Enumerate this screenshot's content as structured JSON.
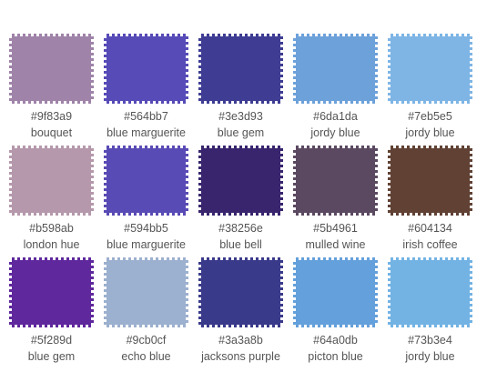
{
  "colors": [
    {
      "hex": "#9f83a9",
      "name": "bouquet"
    },
    {
      "hex": "#564bb7",
      "name": "blue marguerite"
    },
    {
      "hex": "#3e3d93",
      "name": "blue gem"
    },
    {
      "hex": "#6da1da",
      "name": "jordy blue"
    },
    {
      "hex": "#7eb5e5",
      "name": "jordy blue"
    },
    {
      "hex": "#b598ab",
      "name": "london hue"
    },
    {
      "hex": "#594bb5",
      "name": "blue marguerite"
    },
    {
      "hex": "#38256e",
      "name": "blue bell"
    },
    {
      "hex": "#5b4961",
      "name": "mulled wine"
    },
    {
      "hex": "#604134",
      "name": "irish coffee"
    },
    {
      "hex": "#5f289d",
      "name": "blue gem"
    },
    {
      "hex": "#9cb0cf",
      "name": "echo blue"
    },
    {
      "hex": "#3a3a8b",
      "name": "jacksons purple"
    },
    {
      "hex": "#64a0db",
      "name": "picton blue"
    },
    {
      "hex": "#73b3e4",
      "name": "jordy blue"
    }
  ]
}
